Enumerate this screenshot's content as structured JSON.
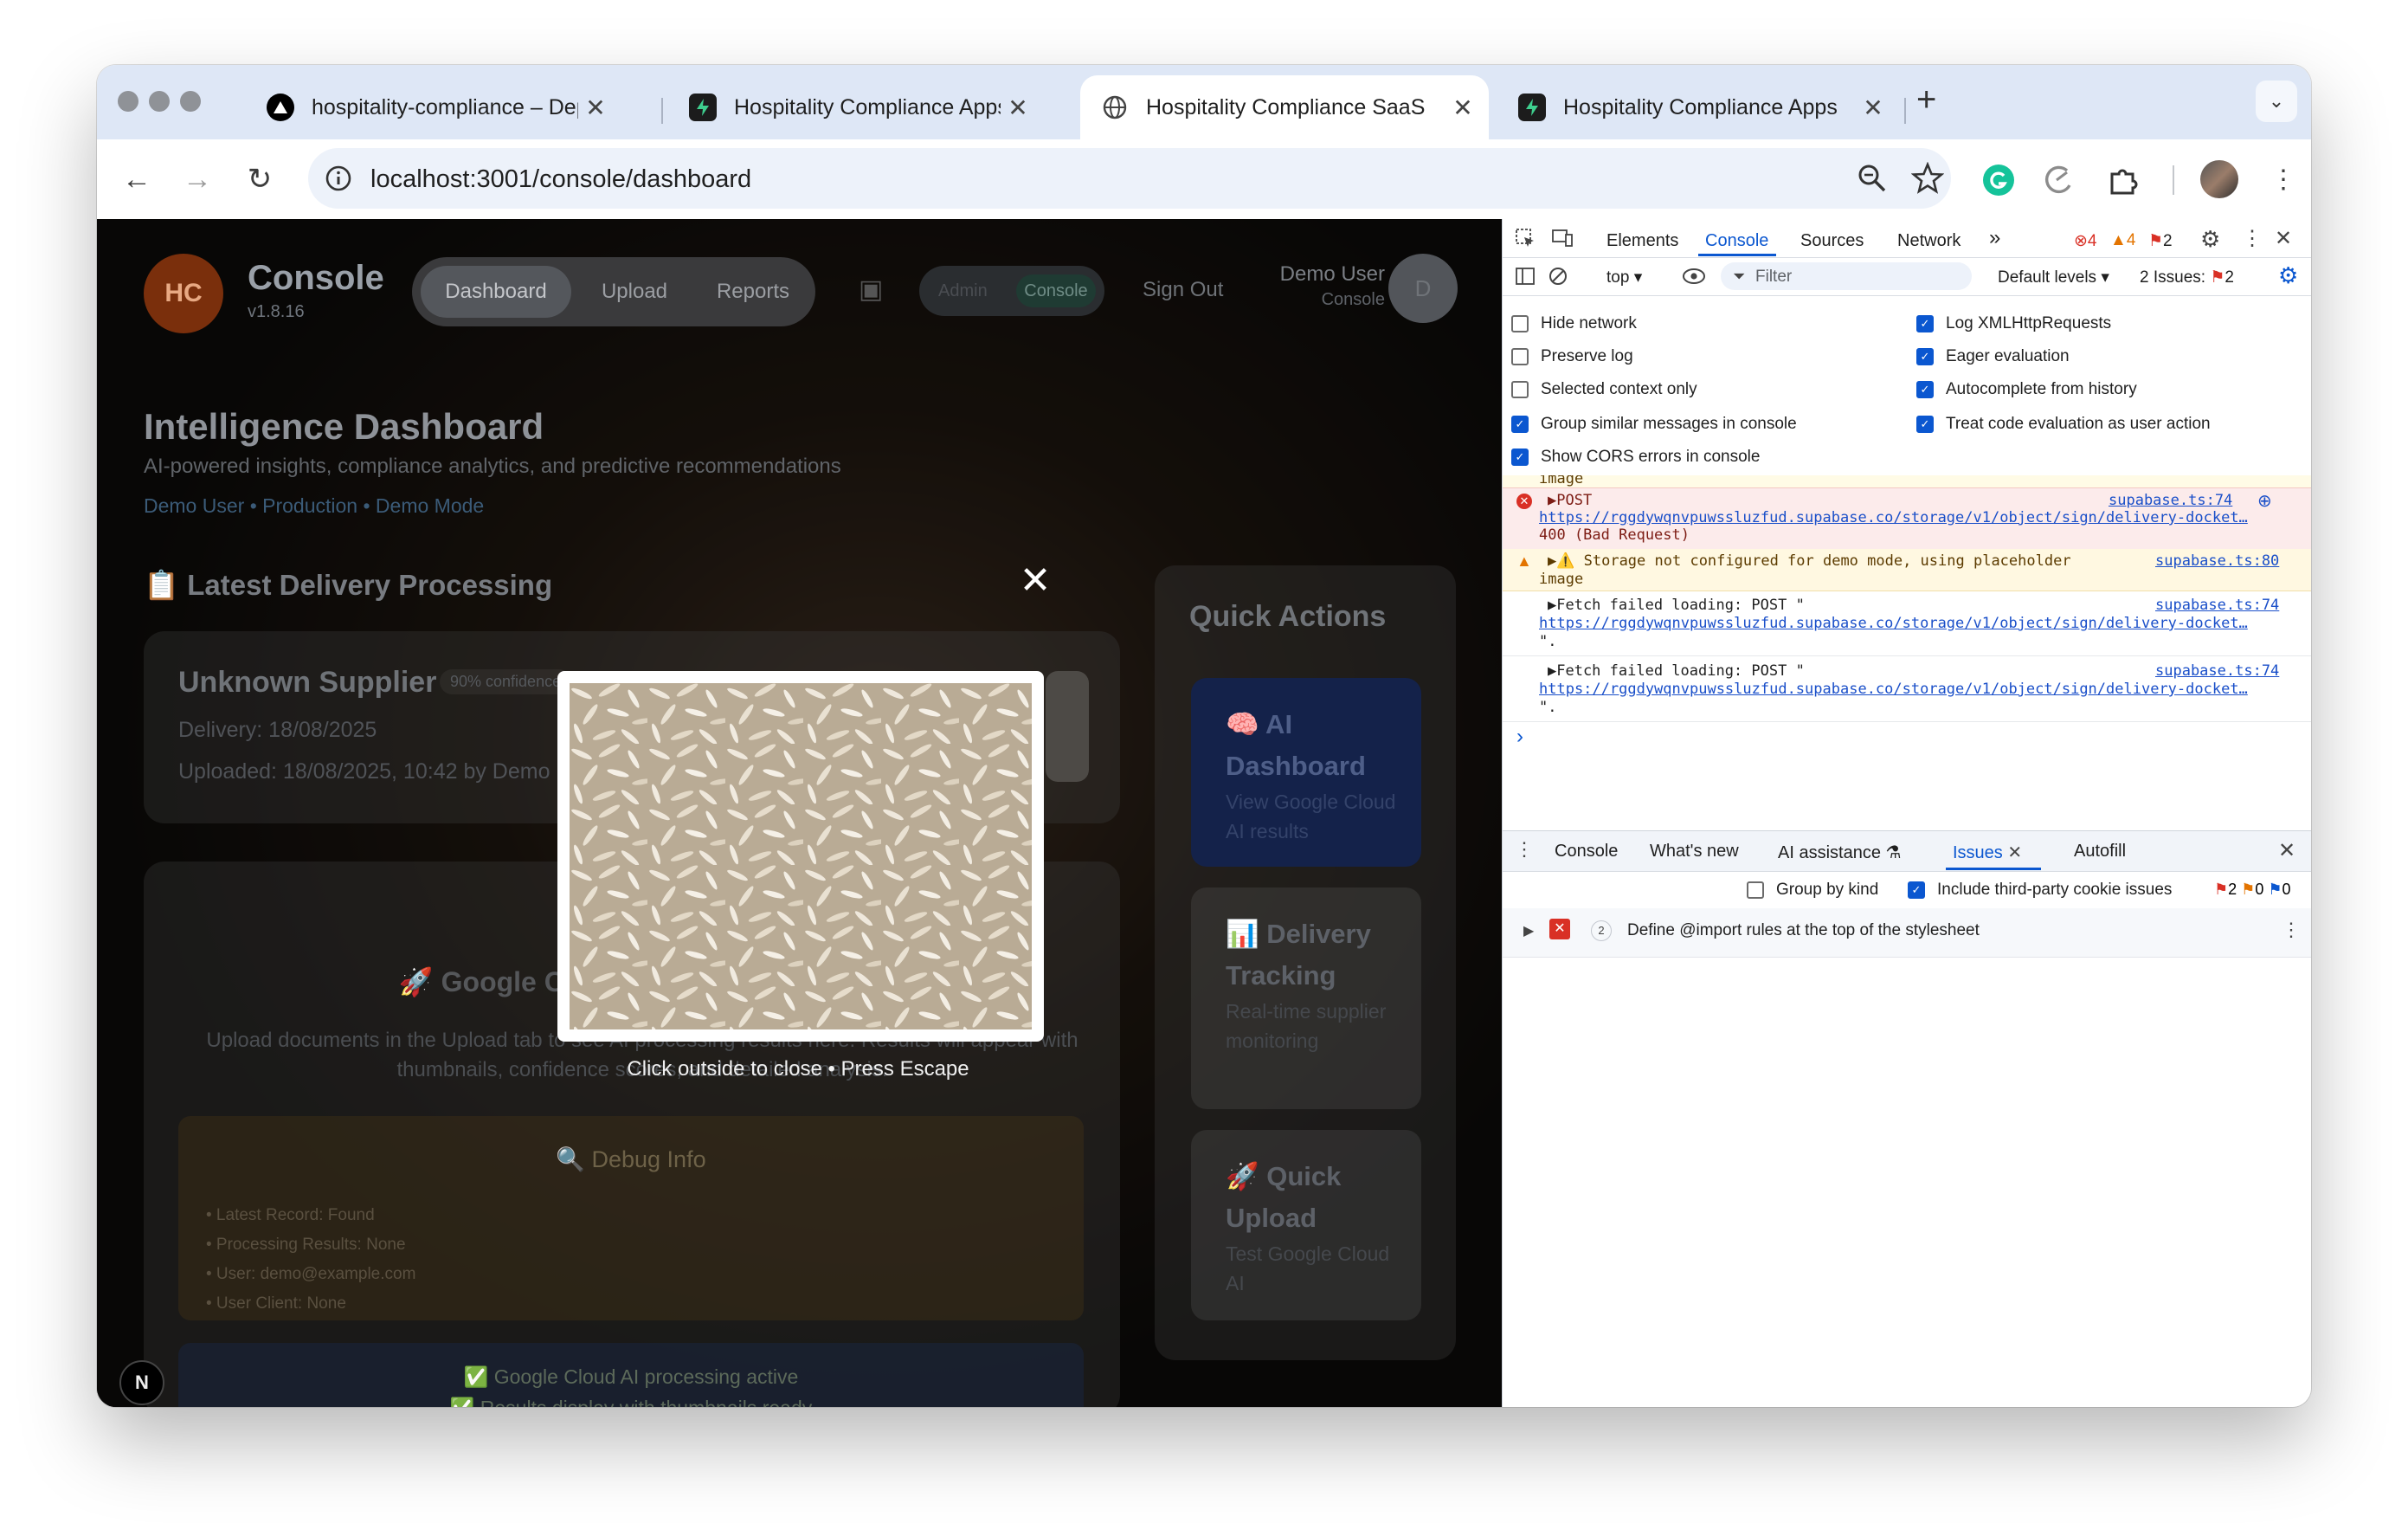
{
  "browser": {
    "tabs": [
      {
        "title": "hospitality-compliance – Dep",
        "favicon": "vercel-icon",
        "active": false
      },
      {
        "title": "Hospitality Compliance Apps",
        "favicon": "supabase-icon",
        "active": false
      },
      {
        "title": "Hospitality Compliance SaaS",
        "favicon": "globe-icon",
        "active": true
      },
      {
        "title": "Hospitality Compliance Apps",
        "favicon": "supabase-icon",
        "active": false
      }
    ],
    "new_tab": "+",
    "close_glyph": "✕",
    "url": "localhost:3001/console/dashboard"
  },
  "app": {
    "logo": "HC",
    "brand": "Console",
    "version": "v1.8.16",
    "nav": [
      "Dashboard",
      "Upload",
      "Reports"
    ],
    "roles": [
      "Admin",
      "Console"
    ],
    "sign_out": "Sign Out",
    "user_name": "Demo User",
    "user_role": "Console",
    "avatar": "D",
    "title": "Intelligence Dashboard",
    "subtitle": "AI-powered insights, compliance analytics, and predictive recommendations",
    "meta": "Demo User • Production • Demo Mode",
    "section_latest": "📋 Latest Delivery Processing",
    "supplier": "Unknown Supplier",
    "confidence": "90% confidence",
    "delivery": "Delivery: 18/08/2025",
    "uploaded": "Uploaded: 18/08/2025, 10:42 by Demo User",
    "gcloud_title": "🚀 Google Cloud AI Dashboard",
    "gcloud_desc": "Upload documents in the Upload tab to see AI processing results here. Results will appear with thumbnails, confidence scores, and detailed analysis.",
    "debug_title": "🔍 Debug Info",
    "debug_items": [
      "• Latest Record: Found",
      "• Processing Results: None",
      "• User: demo@example.com",
      "• User Client: None"
    ],
    "status_lines": [
      "✅ Google Cloud AI processing active",
      "✅ Results display with thumbnails ready"
    ],
    "quick_actions_title": "Quick Actions",
    "quick_actions": [
      {
        "title": "🧠 AI Dashboard",
        "desc": "View Google Cloud AI results"
      },
      {
        "title": "📊 Delivery Tracking",
        "desc": "Real-time supplier monitoring"
      },
      {
        "title": "🚀 Quick Upload",
        "desc": "Test Google Cloud AI"
      }
    ],
    "next_badge": "N",
    "lightbox_close": "✕",
    "lightbox_hint": "Click outside to close • Press Escape"
  },
  "devtools": {
    "tabs": [
      "Elements",
      "Console",
      "Sources",
      "Network"
    ],
    "more": "»",
    "error_count": "4",
    "warning_count": "4",
    "issue_count": "2",
    "context": "top",
    "filter_placeholder": "Filter",
    "levels": "Default levels",
    "issues_label": "2 Issues:",
    "issues_badge": "2",
    "settings_left": [
      {
        "label": "Hide network",
        "checked": false
      },
      {
        "label": "Preserve log",
        "checked": false
      },
      {
        "label": "Selected context only",
        "checked": false
      },
      {
        "label": "Group similar messages in console",
        "checked": true
      },
      {
        "label": "Show CORS errors in console",
        "checked": true
      }
    ],
    "settings_right": [
      {
        "label": "Log XMLHttpRequests",
        "checked": true
      },
      {
        "label": "Eager evaluation",
        "checked": true
      },
      {
        "label": "Autocomplete from history",
        "checked": true
      },
      {
        "label": "Treat code evaluation as user action",
        "checked": true
      }
    ],
    "log_top_fragment": "image",
    "log_error_text": "▶POST",
    "log_error_source": "supabase.ts:74",
    "log_error_url": "https://rggdywqnvpuwssluzfud.supabase.co/storage/v1/object/sign/delivery-docket…",
    "log_error_status": "400 (Bad Request)",
    "log_warn_text": "▶⚠️ Storage not configured for demo mode, using placeholder",
    "log_warn_text2": "image",
    "log_warn_source": "supabase.ts:80",
    "log_fetch": [
      {
        "text": "▶Fetch failed loading: POST \"",
        "source": "supabase.ts:74",
        "url": "https://rggdywqnvpuwssluzfud.supabase.co/storage/v1/object/sign/delivery-docket…",
        "end": "\"."
      },
      {
        "text": "▶Fetch failed loading: POST \"",
        "source": "supabase.ts:74",
        "url": "https://rggdywqnvpuwssluzfud.supabase.co/storage/v1/object/sign/delivery-docket…",
        "end": "\"."
      }
    ],
    "prompt": "›",
    "drawer_tabs": [
      "Console",
      "What's new",
      "AI assistance",
      "Issues",
      "Autofill"
    ],
    "group_by_kind": "Group by kind",
    "include_third_party": "Include third-party cookie issues",
    "issue_counts": [
      "2",
      "0",
      "0"
    ],
    "issue_row_count": "2",
    "issue_row_text": "Define @import rules at the top of the stylesheet"
  },
  "colors": {
    "active_tab_blue": "#0b57d0",
    "error_red": "#d93025",
    "warning_orange": "#e37400",
    "dashboard_bg": "#0c0e12"
  }
}
